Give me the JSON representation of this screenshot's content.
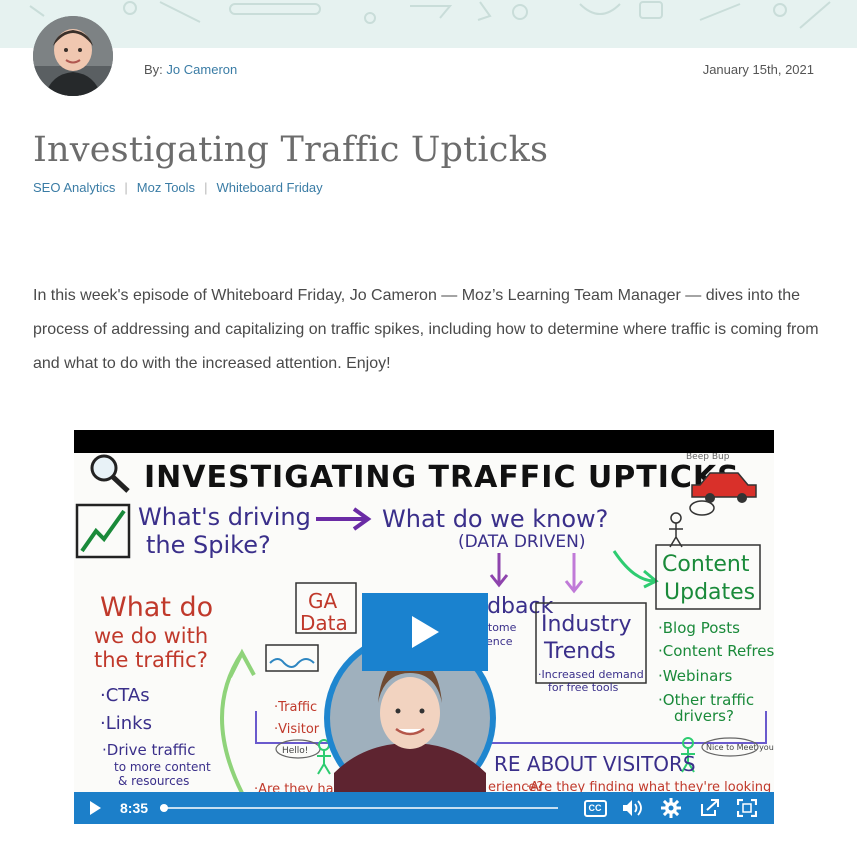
{
  "author": {
    "by_label": "By:",
    "name": "Jo Cameron"
  },
  "date": "January 15th, 2021",
  "title": "Investigating Traffic Upticks",
  "tags": [
    "SEO Analytics",
    "Moz Tools",
    "Whiteboard Friday"
  ],
  "intro": "In this week's episode of Whiteboard Friday, Jo Cameron — Moz’s Learning Team Manager — dives into the process of addressing and capitalizing on traffic spikes, including how to determine where traffic is coming from and what to do with the increased attention. Enjoy!",
  "video": {
    "duration": "8:35",
    "progress": 0,
    "cc_label": "CC",
    "whiteboard": {
      "heading": "INVESTIGATING TRAFFIC UPTICKS",
      "corner_note": "Beep Bup",
      "question_1a": "What's driving",
      "question_1b": "the Spike?",
      "question_2": "What do we know?",
      "data_driven": "(DATA DRIVEN)",
      "ga_1": "GA",
      "ga_2": "Data",
      "feedback": "eedback",
      "feedback_sub1": "·Custome",
      "feedback_sub2": "ence",
      "industry_1": "Industry",
      "industry_2": "Trends",
      "industry_sub1": "·Increased demand",
      "industry_sub2": "for free tools",
      "content_1": "Content",
      "content_2": "Updates",
      "content_items": [
        "·Blog Posts",
        "·Content Refresh",
        "·Webinars",
        "·Other traffic",
        "drivers?"
      ],
      "what_do_1": "What do",
      "what_do_2": "we do with",
      "what_do_3": "the traffic?",
      "actions": [
        "·CTAs",
        "·Links",
        "·Drive traffic"
      ],
      "drive_sub1": "to more content",
      "drive_sub2": "& resources",
      "traffic_1": "·Traffic",
      "traffic_2": "·Visitor",
      "bubble_left": "Hello!",
      "bubble_right": "Nice to Meet you",
      "visitors": "RE ABOUT VISITORS",
      "question_bottom_left": "·Are they havin",
      "question_bottom_mid": "erience?",
      "question_bottom_right": "·Are they finding what they're looking for?"
    }
  },
  "colors": {
    "link": "#3a7ca5",
    "player_blue": "#1c7fc9",
    "banner_bg": "#e6f2f0",
    "title": "#6c6c6c"
  }
}
